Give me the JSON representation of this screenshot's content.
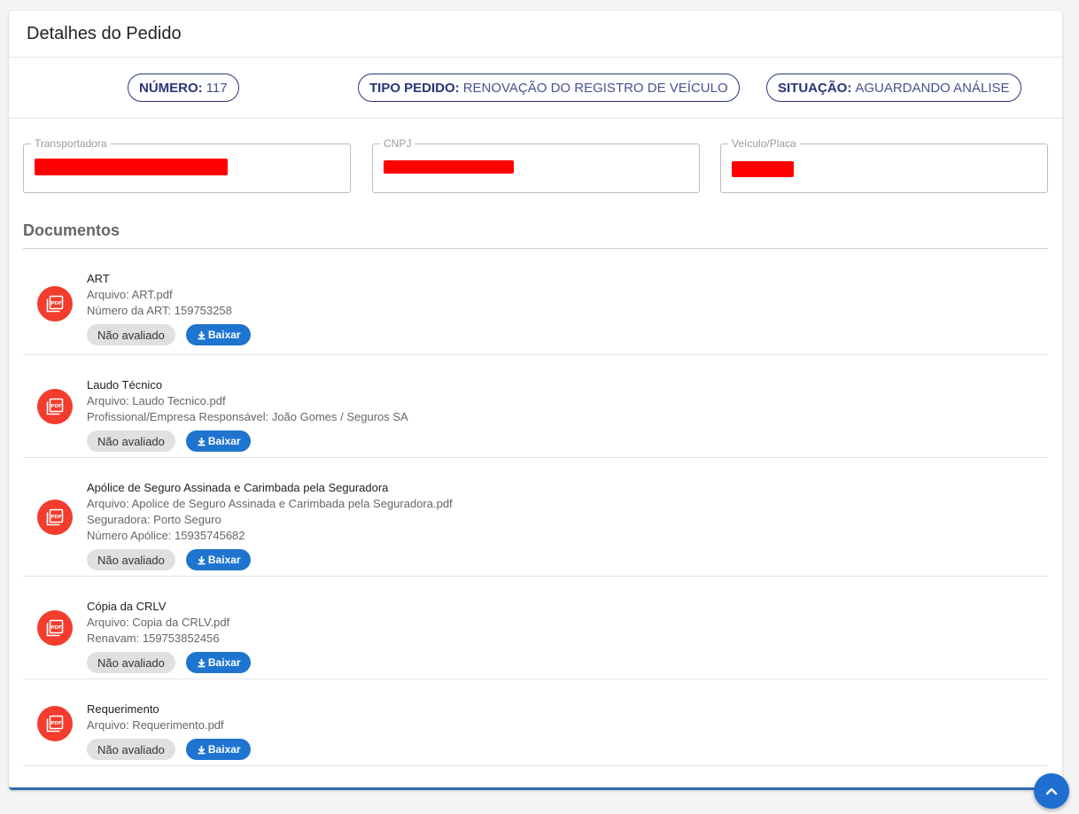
{
  "header": {
    "title": "Detalhes do Pedido"
  },
  "summary": {
    "numero": {
      "key": "NÚMERO:",
      "value": "117"
    },
    "tipo": {
      "key": "TIPO PEDIDO:",
      "value": "RENOVAÇÃO DO REGISTRO DE VEÍCULO"
    },
    "situacao": {
      "key": "SITUAÇÃO:",
      "value": "AGUARDANDO ANÁLISE"
    }
  },
  "fields": {
    "transportadora": {
      "label": "Transportadora"
    },
    "cnpj": {
      "label": "CNPJ"
    },
    "veiculo": {
      "label": "Veículo/Placa"
    }
  },
  "documents_title": "Documentos",
  "documents": [
    {
      "name": "ART",
      "lines": [
        "Arquivo: ART.pdf",
        "Número da ART: 159753258"
      ],
      "status": "Não avaliado",
      "download": "Baixar"
    },
    {
      "name": "Laudo Técnico",
      "lines": [
        "Arquivo: Laudo Tecnico.pdf",
        "Profissional/Empresa Responsável: João Gomes / Seguros SA"
      ],
      "status": "Não avaliado",
      "download": "Baixar"
    },
    {
      "name": "Apólice de Seguro Assinada e Carimbada pela Seguradora",
      "lines": [
        "Arquivo: Apolice de Seguro Assinada e Carimbada pela Seguradora.pdf",
        "Seguradora: Porto Seguro",
        "Número Apólice: 15935745682"
      ],
      "status": "Não avaliado",
      "download": "Baixar"
    },
    {
      "name": "Cópia da CRLV",
      "lines": [
        "Arquivo: Copia da CRLV.pdf",
        "Renavam: 159753852456"
      ],
      "status": "Não avaliado",
      "download": "Baixar"
    },
    {
      "name": "Requerimento",
      "lines": [
        "Arquivo: Requerimento.pdf"
      ],
      "status": "Não avaliado",
      "download": "Baixar"
    }
  ],
  "icons": {
    "document": "pdf-file-icon",
    "download": "download-icon",
    "scroll_top": "chevron-up-icon"
  },
  "colors": {
    "accent": "#1f74d0",
    "chip_border": "#2a3478",
    "pdf_icon": "#f23c2e",
    "redaction": "#ff0000"
  }
}
